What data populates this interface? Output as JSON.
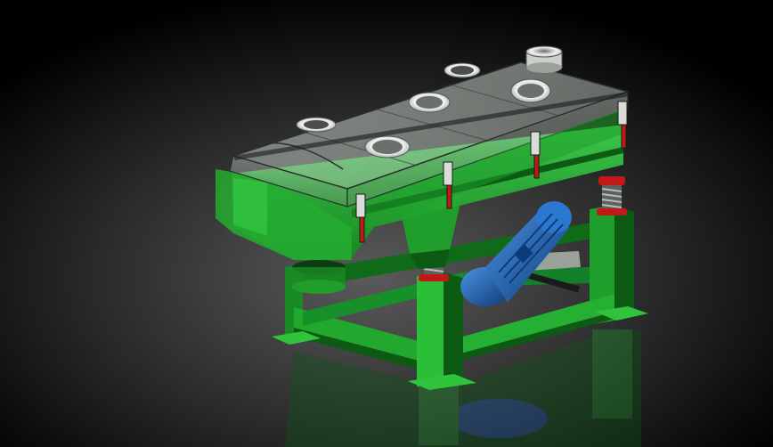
{
  "scene": {
    "subject": "linear-vibrating-screen-render",
    "colors": {
      "background_center": "#5a5a5a",
      "background_edge": "#000000",
      "frame_green": "#1f9e2c",
      "frame_green_dark": "#0c5a14",
      "frame_green_light": "#49d457",
      "screen_box_green": "#2fc43c",
      "cover_glass": "#b9c6bb",
      "motor_blue": "#1d63b8",
      "motor_blue_dark": "#0d3a78",
      "spring_red": "#c21818",
      "spring_steel": "#8a8f8a",
      "port_ring": "#e8ecea"
    },
    "inlet_ports": 5,
    "support_legs": 4,
    "vibration_motors": 1,
    "has_floor_reflection": true
  }
}
